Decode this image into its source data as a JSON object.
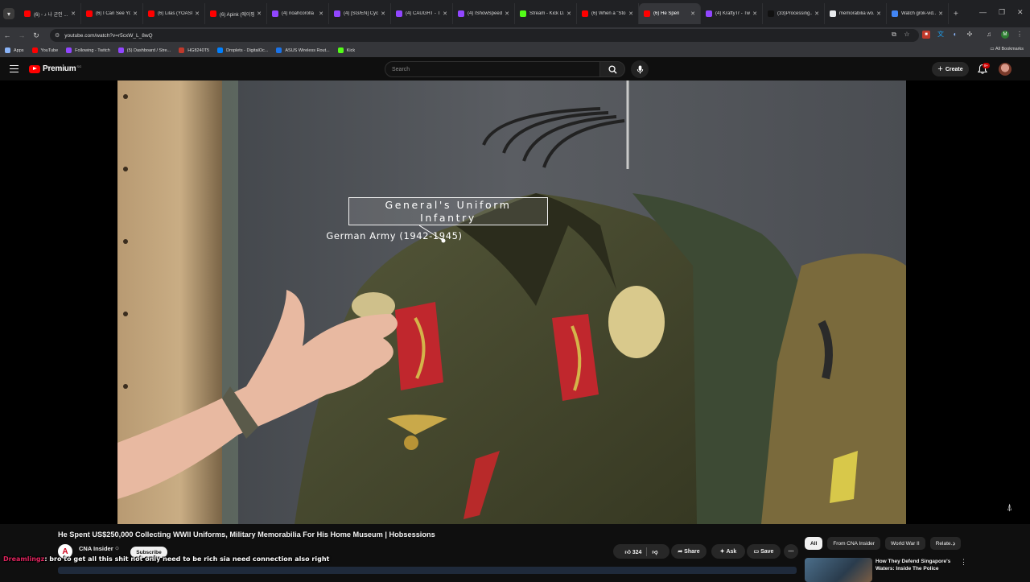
{
  "browser": {
    "tabs": [
      {
        "title": "(6) ◦ ♪ 나 군인 ...",
        "favicon_color": "#ff0000"
      },
      {
        "title": "(6) I Can See Yo...",
        "favicon_color": "#ff0000"
      },
      {
        "title": "(6) Lilas (YOASO...",
        "favicon_color": "#ff0000"
      },
      {
        "title": "(6) Apink (에이핑...",
        "favicon_color": "#ff0000"
      },
      {
        "title": "(4) noahcorolla",
        "favicon_color": "#9146ff"
      },
      {
        "title": "(4) [SG/EN] Cyc...",
        "favicon_color": "#9146ff"
      },
      {
        "title": "(4) CAUGHT - T...",
        "favicon_color": "#9146ff"
      },
      {
        "title": "(4) IShowSpeed",
        "favicon_color": "#9146ff"
      },
      {
        "title": "Stream - Kick D...",
        "favicon_color": "#53fc18"
      },
      {
        "title": "(6) When a \"Sto...",
        "favicon_color": "#ff0000"
      },
      {
        "title": "(6) He Spen",
        "favicon_color": "#ff0000",
        "active": true
      },
      {
        "title": "(4) KraftyTr - Tw...",
        "favicon_color": "#9146ff"
      },
      {
        "title": "(33)Processing...",
        "favicon_color": "#111111"
      },
      {
        "title": "memorabilia wo...",
        "favicon_color": "#e8eaed"
      },
      {
        "title": "Watch grok-vid...",
        "favicon_color": "#4285f4"
      }
    ],
    "new_tab_label": "+",
    "url": "youtube.com/watch?v=r5cxW_L_8wQ",
    "bookmarks": [
      {
        "label": "Apps",
        "color": "#8ab4f8"
      },
      {
        "label": "YouTube",
        "color": "#ff0000"
      },
      {
        "label": "Following - Twitch",
        "color": "#9146ff"
      },
      {
        "label": "(5) Dashboard / Stre...",
        "color": "#9146ff"
      },
      {
        "label": "HG8240T5",
        "color": "#c0392b"
      },
      {
        "label": "Droplets - DigitalOc...",
        "color": "#0080ff"
      },
      {
        "label": "ASUS Wireless Rout...",
        "color": "#1a73e8"
      },
      {
        "label": "Kick",
        "color": "#53fc18"
      }
    ],
    "all_bookmarks_label": "All Bookmarks",
    "profile_initial": "M"
  },
  "youtube": {
    "logo_text": "Premium",
    "country_code": "SG",
    "search_placeholder": "Search",
    "create_label": "Create",
    "notification_count": "9+",
    "video": {
      "caption_line1": "General's Uniform",
      "caption_line2": "Infantry",
      "caption_line3": "German Army (1942-1945)"
    },
    "title": "He Spent US$250,000 Collecting WWII Uniforms, Military Memorabilia For His Home Museum | Hobsessions",
    "channel": {
      "name": "CNA Insider",
      "avatar_letter": "A",
      "subscribe_label": "Subscribe"
    },
    "actions": {
      "like_count": "324",
      "share_label": "Share",
      "ask_label": "Ask",
      "save_label": "Save"
    },
    "chips": [
      {
        "label": "All",
        "active": true
      },
      {
        "label": "From CNA Insider"
      },
      {
        "label": "World War II"
      },
      {
        "label": "Relate..."
      }
    ],
    "recommendation": {
      "title": "How They Defend Singapore's Waters: Inside The Police Coa..."
    }
  },
  "chat_overlay": {
    "user": "Dreamlingz",
    "message": "bro to get all this shit not only need to be rich sia need connection also right"
  }
}
